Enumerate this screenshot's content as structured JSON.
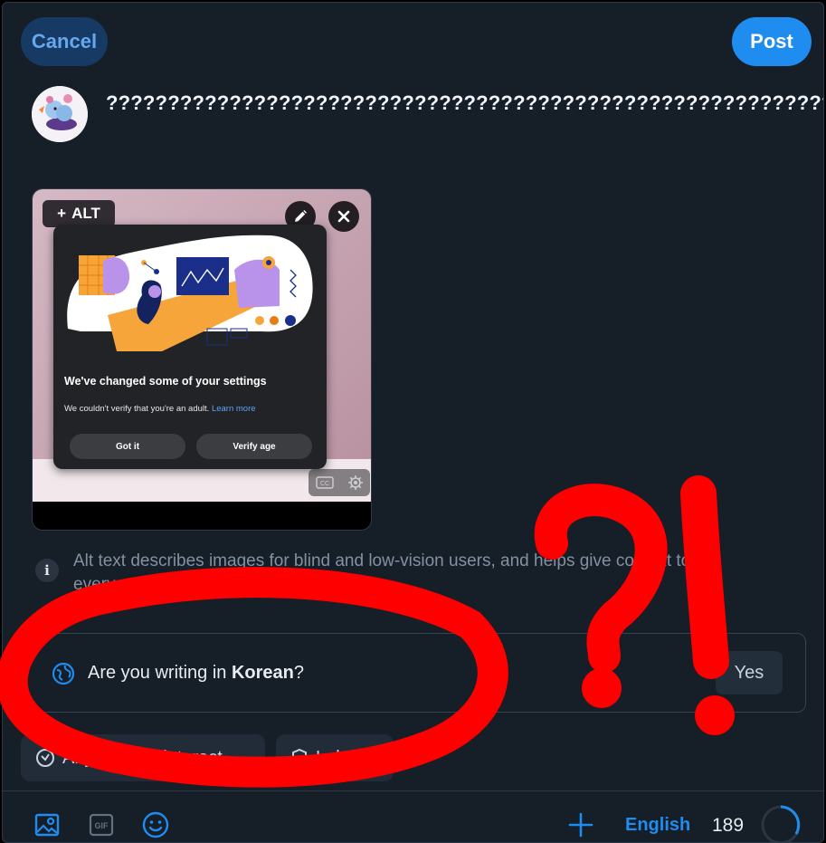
{
  "header": {
    "cancel_label": "Cancel",
    "post_label": "Post"
  },
  "composer": {
    "text": "?????????????????????????????????????????????????????????????????????????????????????????????????????????????????????????????????????????????????????????"
  },
  "media": {
    "alt_label": "ALT",
    "popup": {
      "title": "We've changed some of your settings",
      "text": "We couldn't verify that you're an adult.",
      "link": "Learn more",
      "got_it": "Got it",
      "verify": "Verify age"
    }
  },
  "info": {
    "text": "Alt text describes images for blind and low-vision users, and helps give context to everyone."
  },
  "language_prompt": {
    "question_prefix": "Are you writing in ",
    "language": "Korean",
    "question_suffix": "?",
    "yes_label": "Yes"
  },
  "options": {
    "interact_label": "Anyone can interact",
    "labels_label": "Labels"
  },
  "toolbar": {
    "language": "English",
    "char_count": "189"
  },
  "annotation": {
    "text": "?!",
    "color": "#ff0000"
  },
  "colors": {
    "accent": "#1f8cf0",
    "background": "#161e27"
  }
}
